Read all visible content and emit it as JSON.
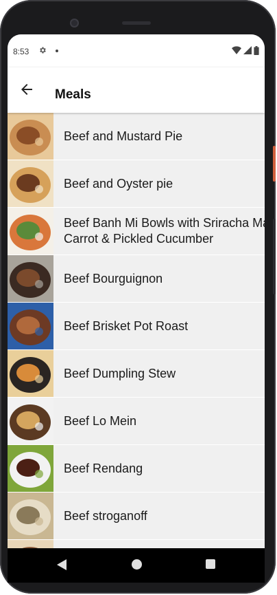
{
  "status": {
    "time": "8:53",
    "icons": [
      "settings-icon",
      "notification-dot",
      "wifi-icon",
      "signal-icon",
      "battery-icon"
    ]
  },
  "appbar": {
    "title": "Meals",
    "back_icon": "arrow-back-icon"
  },
  "meals": [
    {
      "name": "Beef and Mustard Pie",
      "colors": [
        "#c98d52",
        "#8a4d26",
        "#e8c99a"
      ]
    },
    {
      "name": "Beef and Oyster pie",
      "colors": [
        "#d6a15a",
        "#6b3b1f",
        "#f0e1c4"
      ]
    },
    {
      "name": "Beef Banh Mi Bowls with Sriracha Mayo,\nCarrot & Pickled Cucumber",
      "colors": [
        "#d9773b",
        "#5a8a3a",
        "#f4f0e8"
      ]
    },
    {
      "name": "Beef Bourguignon",
      "colors": [
        "#3b2a22",
        "#7b4a2c",
        "#a8a39a"
      ]
    },
    {
      "name": "Beef Brisket Pot Roast",
      "colors": [
        "#6d3a24",
        "#b0693c",
        "#2d5fa8"
      ]
    },
    {
      "name": "Beef Dumpling Stew",
      "colors": [
        "#2a2522",
        "#d88b3a",
        "#e9cf9a"
      ]
    },
    {
      "name": "Beef Lo Mein",
      "colors": [
        "#5b3a22",
        "#d4a55e",
        "#f2f2f2"
      ]
    },
    {
      "name": "Beef Rendang",
      "colors": [
        "#f2f2f2",
        "#4b1f14",
        "#7fa63a"
      ]
    },
    {
      "name": "Beef stroganoff",
      "colors": [
        "#e6dcc6",
        "#8a7a5a",
        "#c9b792"
      ]
    },
    {
      "name": "",
      "colors": [
        "#8a5a3a",
        "#c49b6a",
        "#e8d6b8"
      ]
    }
  ],
  "nav": {
    "back": "nav-back-icon",
    "home": "nav-home-icon",
    "recent": "nav-recent-icon"
  }
}
